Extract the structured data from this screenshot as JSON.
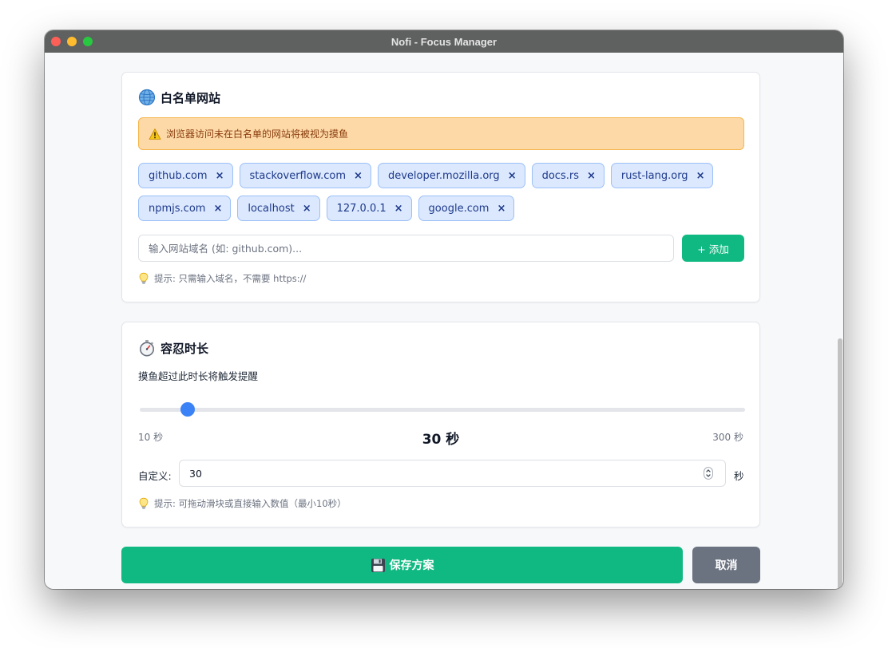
{
  "window": {
    "title": "Nofi - Focus Manager"
  },
  "whitelist": {
    "title": "白名单网站",
    "icon": "globe-icon",
    "warning": {
      "icon": "warning-icon",
      "text": "浏览器访问未在白名单的网站将被视为摸鱼"
    },
    "sites": [
      {
        "name": "github.com",
        "remove": "×"
      },
      {
        "name": "stackoverflow.com",
        "remove": "×"
      },
      {
        "name": "developer.mozilla.org",
        "remove": "×"
      },
      {
        "name": "docs.rs",
        "remove": "×"
      },
      {
        "name": "rust-lang.org",
        "remove": "×"
      },
      {
        "name": "npmjs.com",
        "remove": "×"
      },
      {
        "name": "localhost",
        "remove": "×"
      },
      {
        "name": "127.0.0.1",
        "remove": "×"
      },
      {
        "name": "google.com",
        "remove": "×"
      }
    ],
    "input": {
      "placeholder": "输入网站域名 (如: github.com)...",
      "value": ""
    },
    "add_label": "+ 添加",
    "hint": {
      "icon": "lightbulb-icon",
      "text": "提示: 只需输入域名，不需要 https://"
    }
  },
  "tolerance": {
    "title": "容忍时长",
    "icon": "stopwatch-icon",
    "description": "摸鱼超过此时长将触发提醒",
    "slider": {
      "min": 10,
      "max": 300,
      "value": 30,
      "min_label": "10 秒",
      "max_label": "300 秒",
      "value_label": "30 秒"
    },
    "custom": {
      "label": "自定义:",
      "value": "30",
      "unit": "秒"
    },
    "hint": {
      "icon": "lightbulb-icon",
      "text": "提示: 可拖动滑块或直接输入数值（最小10秒）"
    }
  },
  "actions": {
    "save_label": "保存方案",
    "save_icon": "floppy-disk-icon",
    "cancel_label": "取消"
  },
  "colors": {
    "accent": "#10b981",
    "slider": "#3b82f6",
    "tag_bg": "#dbe8fe",
    "warning_bg": "#fdd9a8",
    "cancel": "#6b7280"
  }
}
